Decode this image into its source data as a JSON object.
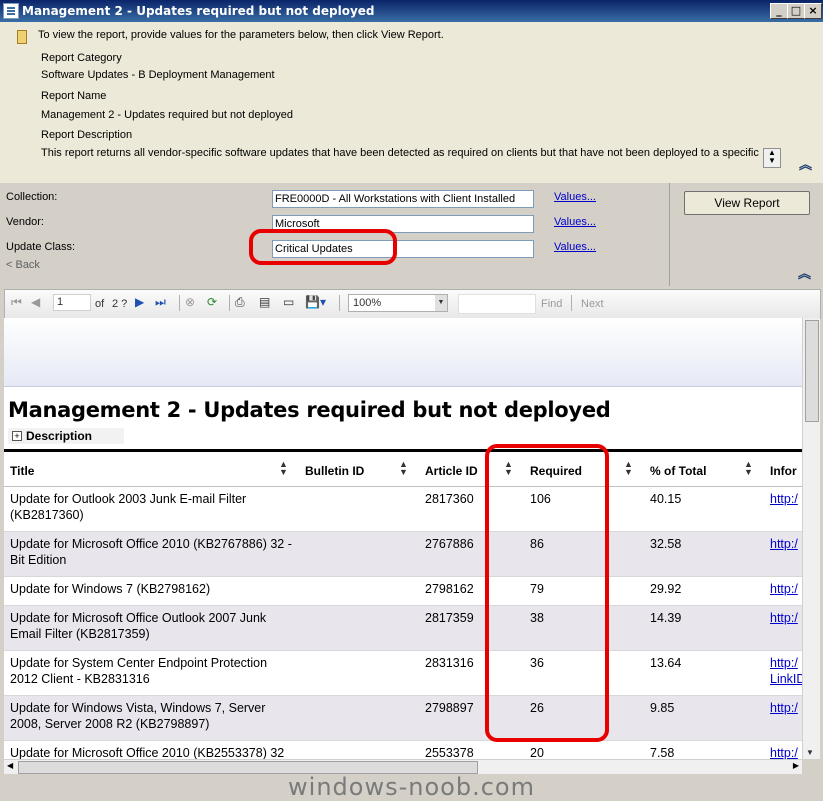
{
  "window": {
    "title": "Management 2 - Updates required but not deployed"
  },
  "info": {
    "prompt": "To view the report, provide values for the parameters below, then click View Report.",
    "category_label": "Report Category",
    "category_value": "Software Updates - B Deployment Management",
    "name_label": "Report Name",
    "name_value": "Management 2 - Updates required but not deployed",
    "desc_label": "Report Description",
    "desc_value": "This report returns all vendor-specific software updates that have been detected as required on clients but that have not been deployed to a specific"
  },
  "params": {
    "collection_label": "Collection:",
    "collection_value": "FRE0000D - All Workstations with Client Installed",
    "vendor_label": "Vendor:",
    "vendor_value": "Microsoft",
    "class_label": "Update Class:",
    "class_value": "Critical Updates",
    "values_link": "Values...",
    "back": "< Back",
    "view_report": "View Report"
  },
  "toolbar": {
    "page": "1",
    "of": "of",
    "total": "2 ?",
    "zoom": "100%",
    "find": "Find",
    "next": "Next"
  },
  "report": {
    "title": "Management 2 - Updates required but not deployed",
    "description": "Description",
    "columns": [
      "Title",
      "Bulletin ID",
      "Article ID",
      "Required",
      "% of Total",
      "Infor"
    ],
    "rows": [
      {
        "title": "Update for Outlook 2003 Junk E-mail Filter (KB2817360)",
        "bulletin": "",
        "article": "2817360",
        "required": "106",
        "pct": "40.15",
        "info": "http:/"
      },
      {
        "title": "Update for Microsoft Office 2010 (KB2767886) 32 -Bit Edition",
        "bulletin": "",
        "article": "2767886",
        "required": "86",
        "pct": "32.58",
        "info": "http:/"
      },
      {
        "title": "Update for Windows 7 (KB2798162)",
        "bulletin": "",
        "article": "2798162",
        "required": "79",
        "pct": "29.92",
        "info": "http:/"
      },
      {
        "title": "Update for Microsoft Office Outlook 2007 Junk Email Filter (KB2817359)",
        "bulletin": "",
        "article": "2817359",
        "required": "38",
        "pct": "14.39",
        "info": "http:/"
      },
      {
        "title": "Update for System Center Endpoint Protection 2012 Client - KB2831316",
        "bulletin": "",
        "article": "2831316",
        "required": "36",
        "pct": "13.64",
        "info": "http:/",
        "info2": "LinkID"
      },
      {
        "title": "Update for Windows Vista, Windows 7, Server 2008, Server 2008 R2 (KB2798897)",
        "bulletin": "",
        "article": "2798897",
        "required": "26",
        "pct": "9.85",
        "info": "http:/"
      },
      {
        "title": "Update for Microsoft Office 2010 (KB2553378) 32",
        "bulletin": "",
        "article": "2553378",
        "required": "20",
        "pct": "7.58",
        "info": "http:/"
      }
    ]
  },
  "watermark": "windows-noob.com"
}
